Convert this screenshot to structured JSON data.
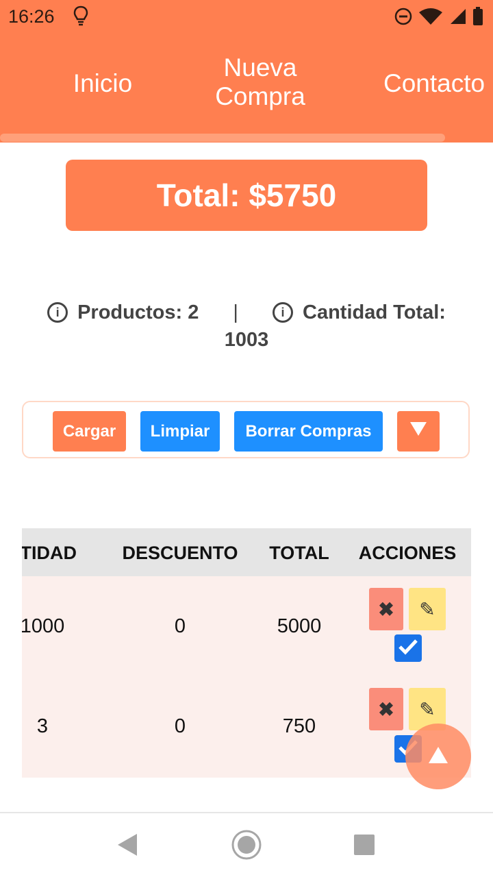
{
  "status_bar": {
    "time": "16:26",
    "icons": [
      "lightbulb-icon",
      "do-not-disturb-icon",
      "wifi-icon",
      "signal-icon",
      "battery-icon"
    ]
  },
  "nav": {
    "items": [
      {
        "label": "Inicio"
      },
      {
        "label_line1": "Nueva",
        "label_line2": "Compra",
        "active": true
      },
      {
        "label": "Contacto"
      }
    ]
  },
  "total": {
    "label": "Total: $5750"
  },
  "summary": {
    "productos_label": "Productos: 2",
    "separator": "|",
    "cantidad_label": "Cantidad Total:",
    "cantidad_value": "1003"
  },
  "toolbar": {
    "cargar": "Cargar",
    "limpiar": "Limpiar",
    "borrar": "Borrar Compras",
    "toggle_icon": "triangle-down-icon"
  },
  "table": {
    "headers": [
      "NTIDAD",
      "DESCUENTO",
      "TOTAL",
      "ACCIONES"
    ],
    "rows": [
      {
        "cantidad": "1000",
        "descuento": "0",
        "total": "5000"
      },
      {
        "cantidad": "3",
        "descuento": "0",
        "total": "750"
      }
    ],
    "action_icons": [
      "close-icon",
      "pencil-icon",
      "checkbox-checked-icon"
    ]
  },
  "colors": {
    "primary": "#ff7f50",
    "accent_blue": "#1e90ff",
    "row_bg": "#fcefec",
    "header_bg": "#e5e5e5",
    "delete_bg": "#fa8d7a",
    "edit_bg": "#ffe484"
  }
}
